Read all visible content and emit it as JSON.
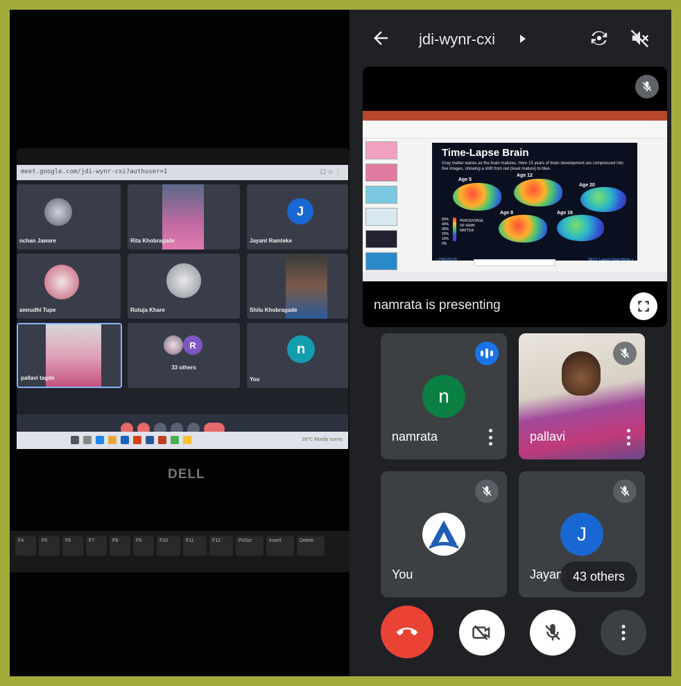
{
  "meet": {
    "code": "jdi-wynr-cxi",
    "presenting_label": "namrata is presenting"
  },
  "participants": [
    {
      "name": "namrata",
      "initial": "n",
      "avatar_color": "#0b8043",
      "state": "speaking"
    },
    {
      "name": "pallavi",
      "state": "muted",
      "video": true
    },
    {
      "name": "You",
      "state": "muted"
    },
    {
      "name": "Jayant",
      "initial": "J",
      "avatar_color": "#1967d2",
      "state": "muted",
      "overlay": "43 others"
    }
  ],
  "slide": {
    "title": "Time-Lapse Brain",
    "subtitle": "Gray matter wanes as the brain matures. Here 15 years of brain development are compressed into five images, showing a shift from red (least mature) to blue.",
    "ages": [
      "Age 5",
      "Age 12",
      "Age 20",
      "Age 8",
      "Age 16"
    ],
    "legend": [
      "50%",
      "40%",
      "30%",
      "20%",
      "10%",
      "0%"
    ],
    "legend_label": "PERCENTAGE OF GRAY MATTER",
    "prev": "« PREVIOUS",
    "next": "NEXT: Launch Flash Movie »"
  },
  "laptop": {
    "url": "meet.google.com/jdi-wynr-cxi?authuser=1",
    "brand": "DELL",
    "tiles": [
      {
        "name": "nchan Jaware"
      },
      {
        "name": "Rita Khobragade"
      },
      {
        "name": "Jayant Ramteke",
        "initial": "J"
      },
      {
        "name": "amrudhi Tupe"
      },
      {
        "name": "Rutuja Khare"
      },
      {
        "name": "Shilu Khobragade"
      },
      {
        "name": "pallavi tagde"
      },
      {
        "name": "33 others",
        "initial": "R"
      },
      {
        "name": "You",
        "initial": "n"
      }
    ],
    "weather": "26°C  Mostly sunny",
    "keys": [
      "F4",
      "F5",
      "F6",
      "F7",
      "F8",
      "F9",
      "F10",
      "F11",
      "F12",
      "PrtScr",
      "Insert",
      "Delete"
    ]
  },
  "colors": {
    "end_call": "#ea4335",
    "tile_bg": "#3c4043",
    "app_bg": "#202124",
    "border": "#a3ac3a"
  }
}
